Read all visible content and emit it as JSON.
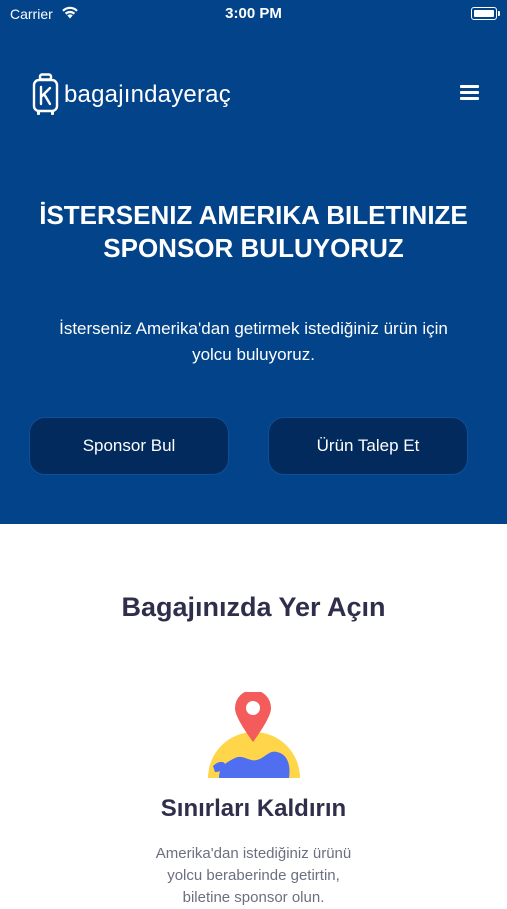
{
  "status_bar": {
    "carrier": "Carrier",
    "time": "3:00 PM"
  },
  "header": {
    "brand": "bagajındayeraç",
    "menu_icon": "hamburger-menu-icon"
  },
  "hero": {
    "title_line1": "İSTERSENIZ AMERIKA BILETINIZE",
    "title_line2": "SPONSOR BULUYORUZ",
    "subtitle_line1": "İsterseniz Amerika'dan getirmek istediğiniz ürün için",
    "subtitle_line2": "yolcu buluyoruz.",
    "buttons": [
      {
        "label": "Sponsor Bul"
      },
      {
        "label": "Ürün Talep Et"
      }
    ]
  },
  "section": {
    "title": "Bagajınızda Yer Açın",
    "feature": {
      "icon": "globe-location-pin-icon",
      "title": "Sınırları Kaldırın",
      "desc_line1": "Amerika'dan istediğiniz ürünü",
      "desc_line2": "yolcu beraberinde getirtin,",
      "desc_line3": "biletine sponsor olun."
    }
  },
  "colors": {
    "hero_bg": "#034389",
    "button_bg": "#022a5c",
    "heading_text": "#2f2e4b",
    "pin_red": "#f45b5b",
    "globe_blue": "#4f6ef0",
    "globe_yellow": "#ffd54a"
  }
}
